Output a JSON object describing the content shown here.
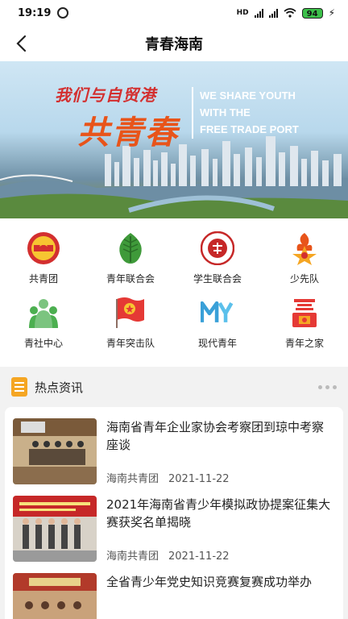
{
  "status_bar": {
    "time": "19:19",
    "network_label": "HD",
    "battery_level": "94"
  },
  "nav": {
    "title": "青春海南"
  },
  "banner": {
    "cn_line1": "我们与自贸港",
    "cn_line2": "共青春",
    "en_line1": "WE SHARE YOUTH",
    "en_line2": "WITH THE",
    "en_line3": "FREE TRADE PORT"
  },
  "menu": {
    "items": [
      {
        "label": "共青团",
        "icon": "youth-league-emblem-icon"
      },
      {
        "label": "青年联合会",
        "icon": "green-leaf-icon"
      },
      {
        "label": "学生联合会",
        "icon": "student-union-emblem-icon"
      },
      {
        "label": "少先队",
        "icon": "young-pioneers-icon"
      },
      {
        "label": "青社中心",
        "icon": "people-group-icon"
      },
      {
        "label": "青年突击队",
        "icon": "red-flag-icon"
      },
      {
        "label": "现代青年",
        "icon": "my-logo-icon"
      },
      {
        "label": "青年之家",
        "icon": "youth-home-icon"
      }
    ]
  },
  "news": {
    "section_title": "热点资讯",
    "items": [
      {
        "title": "海南省青年企业家协会考察团到琼中考察座谈",
        "source": "海南共青团",
        "date": "2021-11-22"
      },
      {
        "title": "2021年海南省青少年模拟政协提案征集大赛获奖名单揭晓",
        "source": "海南共青团",
        "date": "2021-11-22"
      },
      {
        "title": "全省青少年党史知识竞赛复赛成功举办",
        "source": "",
        "date": ""
      }
    ]
  },
  "colors": {
    "accent_orange": "#f5a623",
    "league_red": "#d32f2f",
    "leaf_green": "#3f9a3a"
  }
}
